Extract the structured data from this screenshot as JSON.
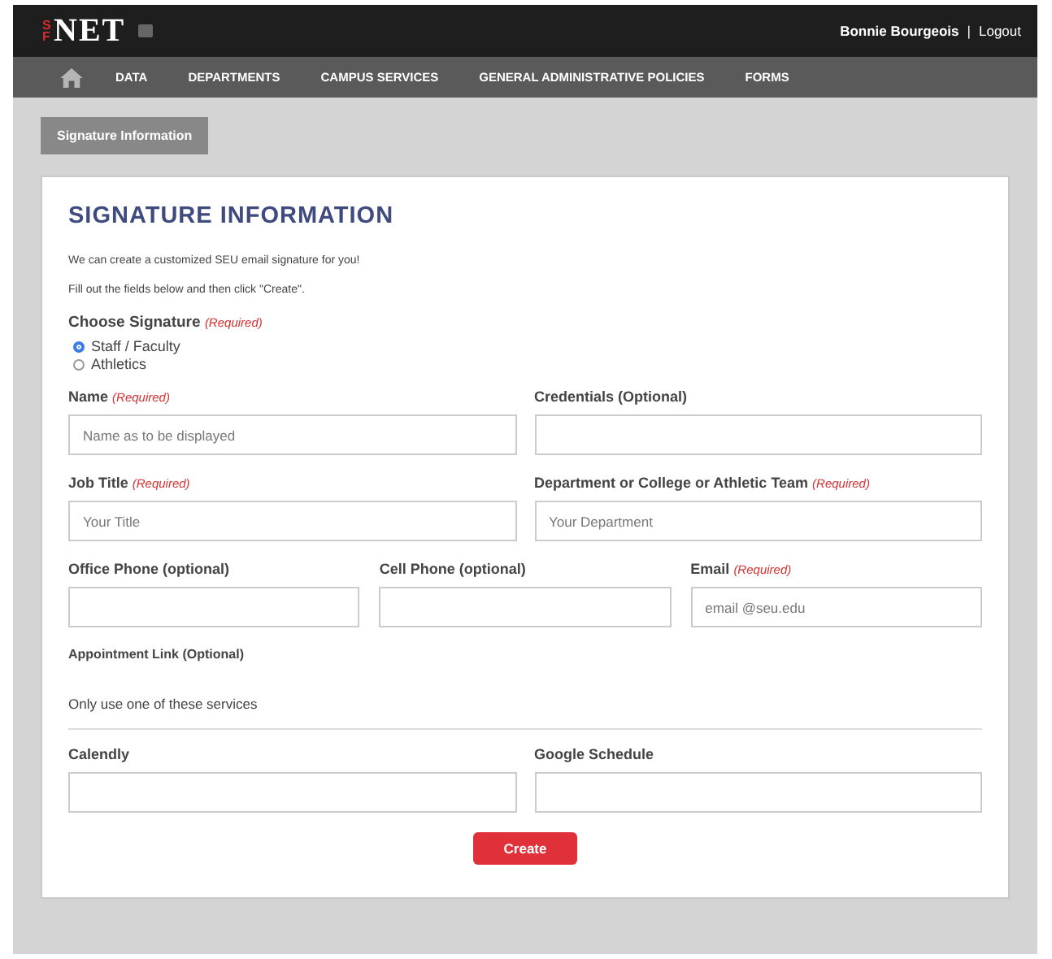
{
  "header": {
    "logo_prefix": "SF",
    "logo": "NET",
    "user": "Bonnie Bourgeois",
    "separator": "|",
    "logout": "Logout"
  },
  "nav": [
    "DATA",
    "DEPARTMENTS",
    "CAMPUS SERVICES",
    "GENERAL ADMINISTRATIVE POLICIES",
    "FORMS"
  ],
  "breadcrumb_tab": "Signature Information",
  "form": {
    "title": "SIGNATURE INFORMATION",
    "intro": [
      "We can create a customized SEU email signature for you!",
      "Fill out the fields below and then click \"Create\"."
    ],
    "choose": {
      "label": "Choose Signature",
      "required": "(Required)",
      "options": [
        {
          "label": "Staff / Faculty",
          "selected": true
        },
        {
          "label": "Athletics",
          "selected": false
        }
      ]
    },
    "rows": [
      [
        {
          "label": "Name",
          "tag": "(Required)",
          "placeholder": "Name as to be displayed"
        },
        {
          "label": "Credentials (Optional)"
        }
      ],
      [
        {
          "label": "Job Title",
          "tag": "(Required)",
          "placeholder": "Your Title"
        },
        {
          "label": "Department or College or Athletic Team",
          "tag": "(Required)",
          "placeholder": "Your Department"
        }
      ],
      [
        {
          "label": "Office Phone (optional)"
        },
        {
          "label": "Cell Phone (optional)"
        },
        {
          "label": "Email",
          "tag": "(Required)",
          "placeholder": "email @seu.edu"
        }
      ]
    ],
    "appointment": {
      "label": "Appointment Link (Optional)",
      "note": "Only use one of these services",
      "fields": [
        {
          "label": "Calendly"
        },
        {
          "label": "Google Schedule"
        }
      ]
    },
    "submit": "Create"
  }
}
